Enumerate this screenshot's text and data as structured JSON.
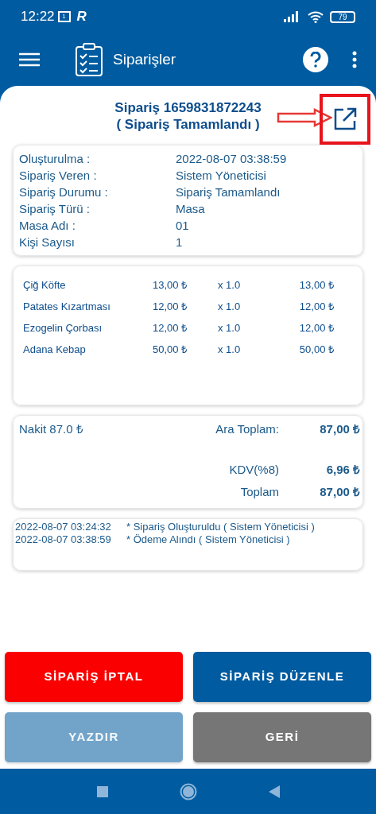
{
  "status_bar": {
    "time": "12:22",
    "calendar_day": "1",
    "app_badge": "R",
    "battery": "79"
  },
  "app_bar": {
    "title": "Siparişler"
  },
  "order": {
    "title": "Sipariş 1659831872243",
    "status": "( Sipariş Tamamlandı )",
    "highlighted": true
  },
  "details": [
    {
      "label": "Oluşturulma :",
      "value": "2022-08-07 03:38:59"
    },
    {
      "label": "Sipariş Veren :",
      "value": "Sistem Yöneticisi"
    },
    {
      "label": "Sipariş Durumu :",
      "value": "Sipariş Tamamlandı"
    },
    {
      "label": "Sipariş Türü :",
      "value": "Masa"
    },
    {
      "label": "Masa Adı :",
      "value": "01"
    },
    {
      "label": "Kişi Sayısı",
      "value": "1"
    }
  ],
  "items": [
    {
      "name": "Çiğ Köfte",
      "price": "13,00 ₺",
      "quantity": "x 1.0",
      "total": "13,00 ₺"
    },
    {
      "name": "Patates Kızartması",
      "price": "12,00 ₺",
      "quantity": "x 1.0",
      "total": "12,00 ₺"
    },
    {
      "name": "Ezogelin Çorbası",
      "price": "12,00 ₺",
      "quantity": "x 1.0",
      "total": "12,00 ₺"
    },
    {
      "name": "Adana Kebap",
      "price": "50,00 ₺",
      "quantity": "x 1.0",
      "total": "50,00 ₺"
    }
  ],
  "payment": {
    "method": "Nakit 87.0 ₺",
    "subtotal_label": "Ara Toplam:",
    "subtotal": "87,00 ₺",
    "tax_label": "KDV(%8)",
    "tax": "6,96 ₺",
    "total_label": "Toplam",
    "total": "87,00 ₺"
  },
  "log": [
    {
      "time": "2022-08-07 03:24:32",
      "message": "* Sipariş Oluşturuldu ( Sistem Yöneticisi )"
    },
    {
      "time": "2022-08-07 03:38:59",
      "message": "* Ödeme Alındı ( Sistem Yöneticisi )"
    }
  ],
  "buttons": [
    {
      "label": "SİPARİŞ İPTAL",
      "kind": "danger",
      "disabled": false
    },
    {
      "label": "SİPARİŞ DÜZENLE",
      "kind": "primary",
      "disabled": false
    },
    {
      "label": "YAZDIR",
      "kind": "primary",
      "disabled": true
    },
    {
      "label": "GERİ",
      "kind": "secondary",
      "disabled": false
    }
  ]
}
